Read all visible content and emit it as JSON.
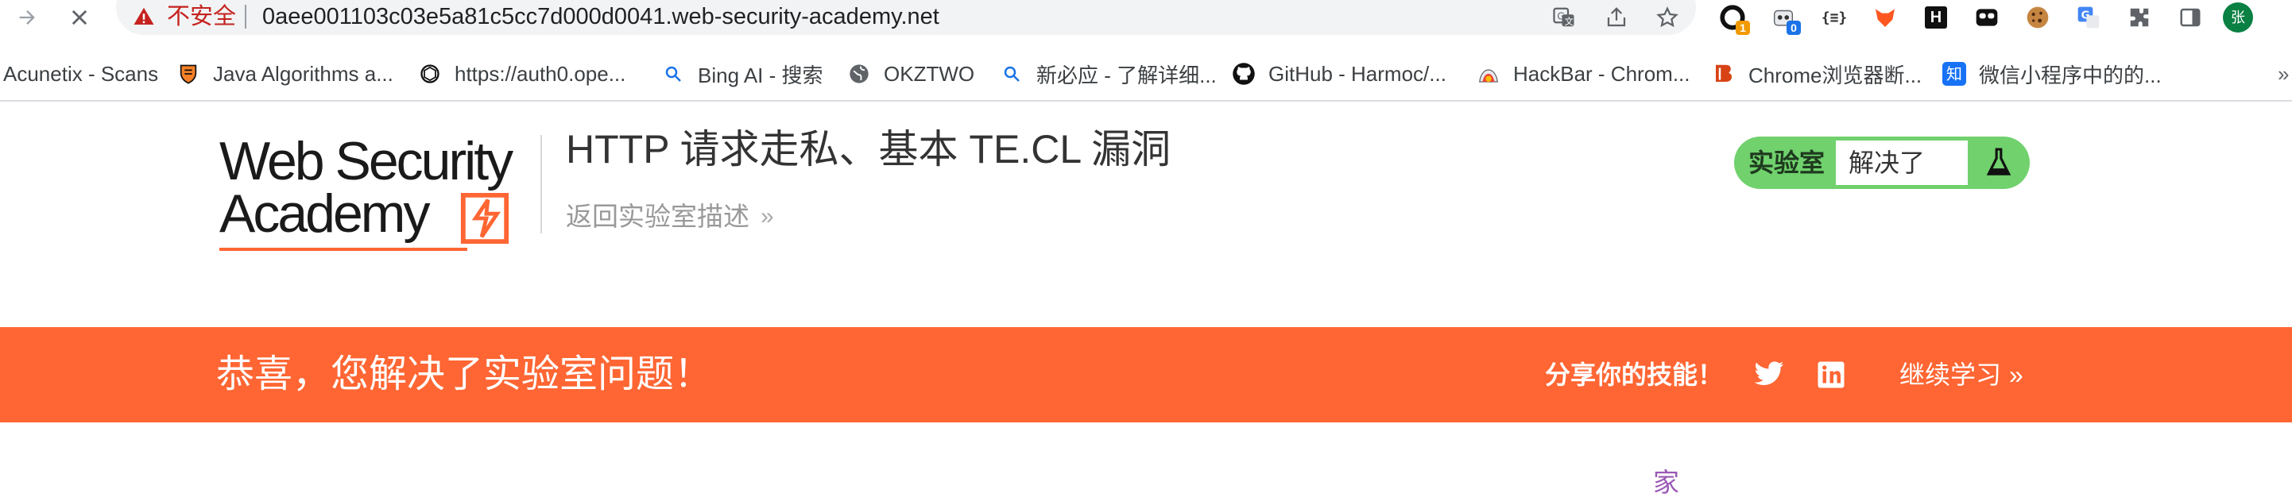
{
  "browser": {
    "insecure_label": "不安全",
    "url": "0aee001103c03e5a81c5cc7d000d0041.web-security-academy.net",
    "extensions": [
      {
        "name": "o-extension-icon",
        "badge": "1",
        "badge_color": "#f29900"
      },
      {
        "name": "robot-extension-icon",
        "badge": "0",
        "badge_color": "#1a73e8"
      },
      {
        "name": "json-extension-icon",
        "text": "{≡}"
      },
      {
        "name": "fox-extension-icon"
      },
      {
        "name": "hackbar-h-icon",
        "text": "H"
      },
      {
        "name": "mask-extension-icon"
      },
      {
        "name": "cookie-extension-icon"
      },
      {
        "name": "translate-extension-icon"
      },
      {
        "name": "puzzle-icon"
      },
      {
        "name": "sidepanel-icon"
      }
    ],
    "profile_initial": "张",
    "profile_color": "#0b8043"
  },
  "bookmarks": [
    {
      "label": "Acunetix - Scans",
      "icon": "none"
    },
    {
      "label": "Java Algorithms a...",
      "icon": "princeton-shield-icon"
    },
    {
      "label": "https://auth0.ope...",
      "icon": "openai-icon"
    },
    {
      "label": "Bing AI - 搜索",
      "icon": "search-icon"
    },
    {
      "label": "OKZTWO",
      "icon": "globe-icon"
    },
    {
      "label": "新必应 - 了解详细...",
      "icon": "search-icon"
    },
    {
      "label": "GitHub - Harmoc/...",
      "icon": "github-icon"
    },
    {
      "label": "HackBar - Chrom...",
      "icon": "chrome-store-icon"
    },
    {
      "label": "Chrome浏览器断...",
      "icon": "b-logo-icon"
    },
    {
      "label": "微信小程序中的的...",
      "icon": "zhihu-icon"
    }
  ],
  "logo": {
    "line1": "Web Security",
    "line2": "Academy"
  },
  "lab": {
    "title": "HTTP 请求走私、基本 TE.CL 漏洞",
    "back_link": "返回实验室描述",
    "status_label": "实验室",
    "status_value": "解决了"
  },
  "banner": {
    "message": "恭喜，您解决了实验室问题！",
    "share": "分享你的技能！",
    "continue": "继续学习"
  },
  "home_link": "家",
  "colors": {
    "accent_orange": "#ff6633",
    "solved_green": "#70d16d",
    "link_purple": "#9b59b6"
  }
}
